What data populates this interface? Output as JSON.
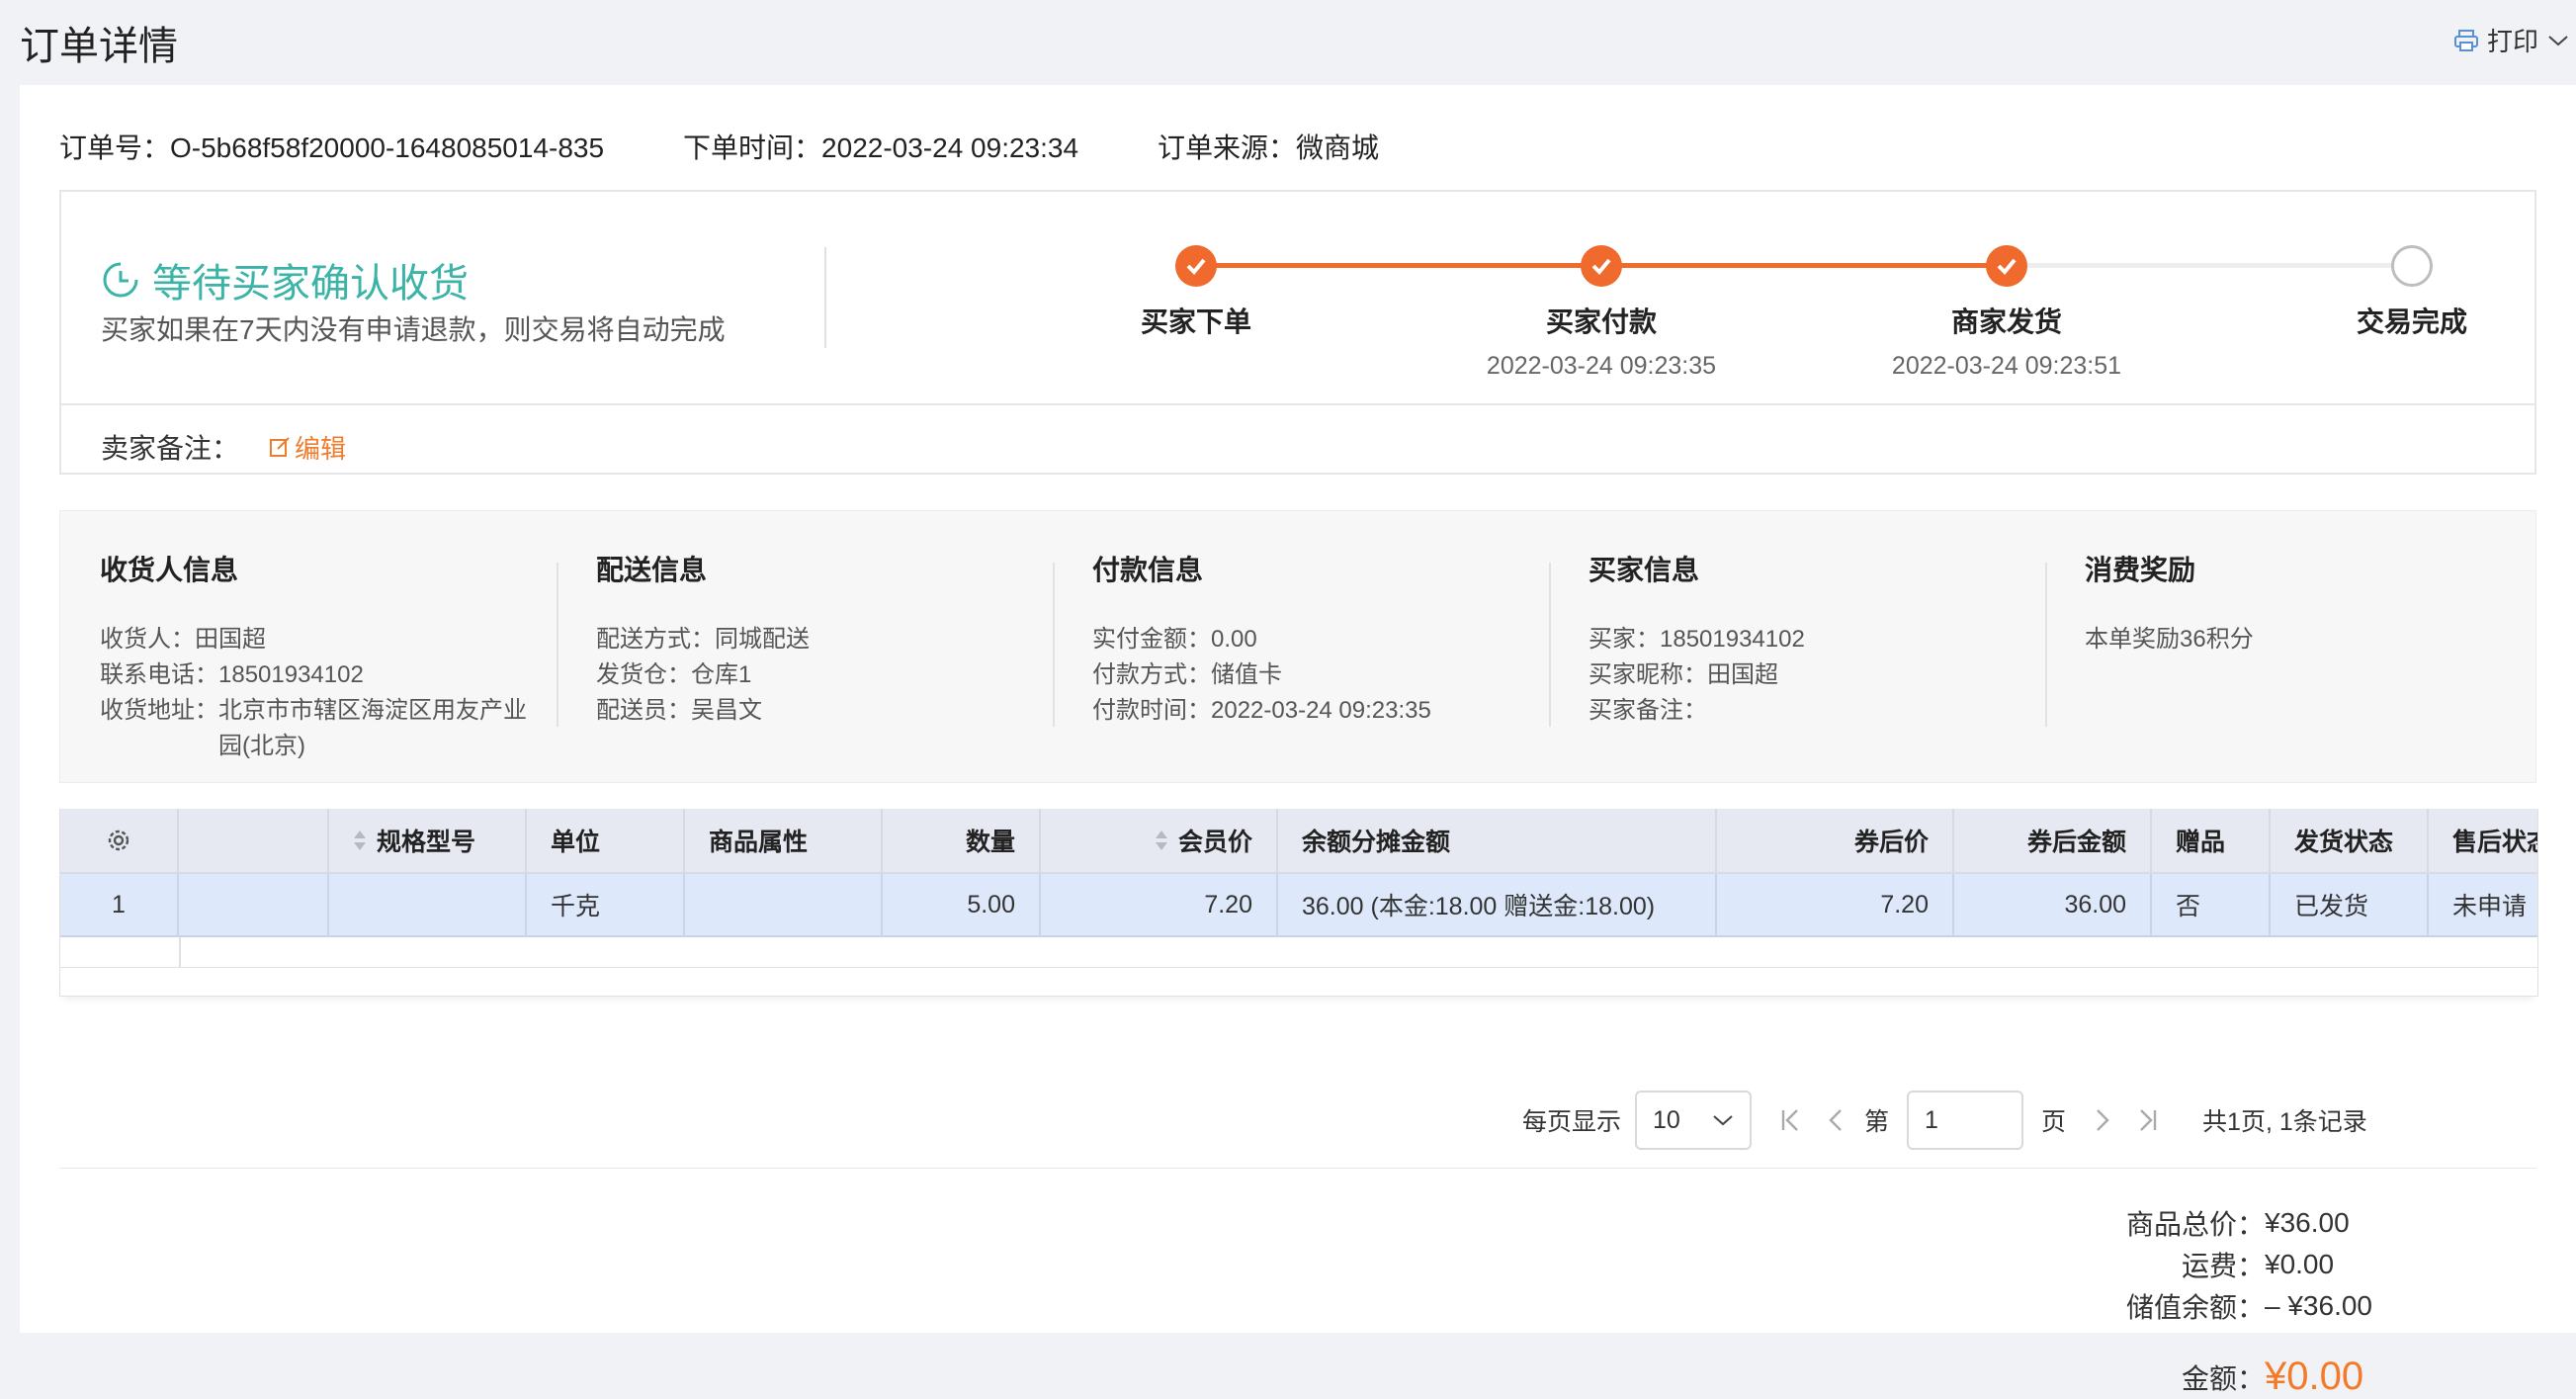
{
  "page": {
    "title": "订单详情",
    "print_label": "打印",
    "accent_color": "#ef6a2c",
    "status_color": "#3bb3a6"
  },
  "order_meta": {
    "order_no": "订单号：O-5b68f58f20000-1648085014-835",
    "order_time": "下单时间：2022-03-24 09:23:34",
    "order_source": "订单来源：微商城"
  },
  "status": {
    "title": "等待买家确认收货",
    "desc": "买家如果在7天内没有申请退款，则交易将自动完成",
    "steps": [
      {
        "label": "买家下单",
        "time": "",
        "done": true
      },
      {
        "label": "买家付款",
        "time": "2022-03-24 09:23:35",
        "done": true
      },
      {
        "label": "商家发货",
        "time": "2022-03-24 09:23:51",
        "done": true
      },
      {
        "label": "交易完成",
        "time": "",
        "done": false
      }
    ]
  },
  "remark": {
    "label": "卖家备注：",
    "edit_label": "编辑"
  },
  "info": {
    "receiver": {
      "title": "收货人信息",
      "name_k": "收货人：",
      "name_v": "田国超",
      "phone_k": "联系电话：",
      "phone_v": "18501934102",
      "addr_k": "收货地址：",
      "addr_v": "北京市市辖区海淀区用友产业园(北京)"
    },
    "delivery": {
      "title": "配送信息",
      "method_k": "配送方式：",
      "method_v": "同城配送",
      "warehouse_k": "发货仓：",
      "warehouse_v": "仓库1",
      "courier_k": "配送员：",
      "courier_v": "吴昌文"
    },
    "payment": {
      "title": "付款信息",
      "amount_k": "实付金额：",
      "amount_v": "0.00",
      "method_k": "付款方式：",
      "method_v": "储值卡",
      "time_k": "付款时间：",
      "time_v": "2022-03-24 09:23:35"
    },
    "buyer": {
      "title": "买家信息",
      "buyer_k": "买家：",
      "buyer_v": "18501934102",
      "nick_k": "买家昵称：",
      "nick_v": "田国超",
      "note_k": "买家备注：",
      "note_v": ""
    },
    "reward": {
      "title": "消费奖励",
      "text": "本单奖励36积分"
    }
  },
  "table": {
    "headers": {
      "spec": "规格型号",
      "unit": "单位",
      "attr": "商品属性",
      "qty": "数量",
      "member_price": "会员价",
      "balance_split": "余额分摊金额",
      "after_coupon_price": "券后价",
      "after_coupon_amount": "券后金额",
      "gift": "赠品",
      "ship_status": "发货状态",
      "after_sale": "售后状态"
    },
    "rows": [
      {
        "index": "1",
        "spec": "",
        "unit": "千克",
        "attr": "",
        "qty": "5.00",
        "member_price": "7.20",
        "balance_split": "36.00 (本金:18.00 赠送金:18.00)",
        "after_coupon_price": "7.20",
        "after_coupon_amount": "36.00",
        "gift": "否",
        "ship_status": "已发货",
        "after_sale": "未申请"
      }
    ]
  },
  "pager": {
    "per_page_label": "每页显示",
    "per_page_value": "10",
    "page_prefix": "第",
    "page_value": "1",
    "page_suffix": "页",
    "summary": "共1页, 1条记录"
  },
  "totals": {
    "goods_k": "商品总价：",
    "goods_v": "¥36.00",
    "freight_k": "运费：",
    "freight_v": "¥0.00",
    "balance_k": "储值余额：",
    "balance_v": "– ¥36.00",
    "amount_k": "金额：",
    "amount_v": "¥0.00"
  }
}
